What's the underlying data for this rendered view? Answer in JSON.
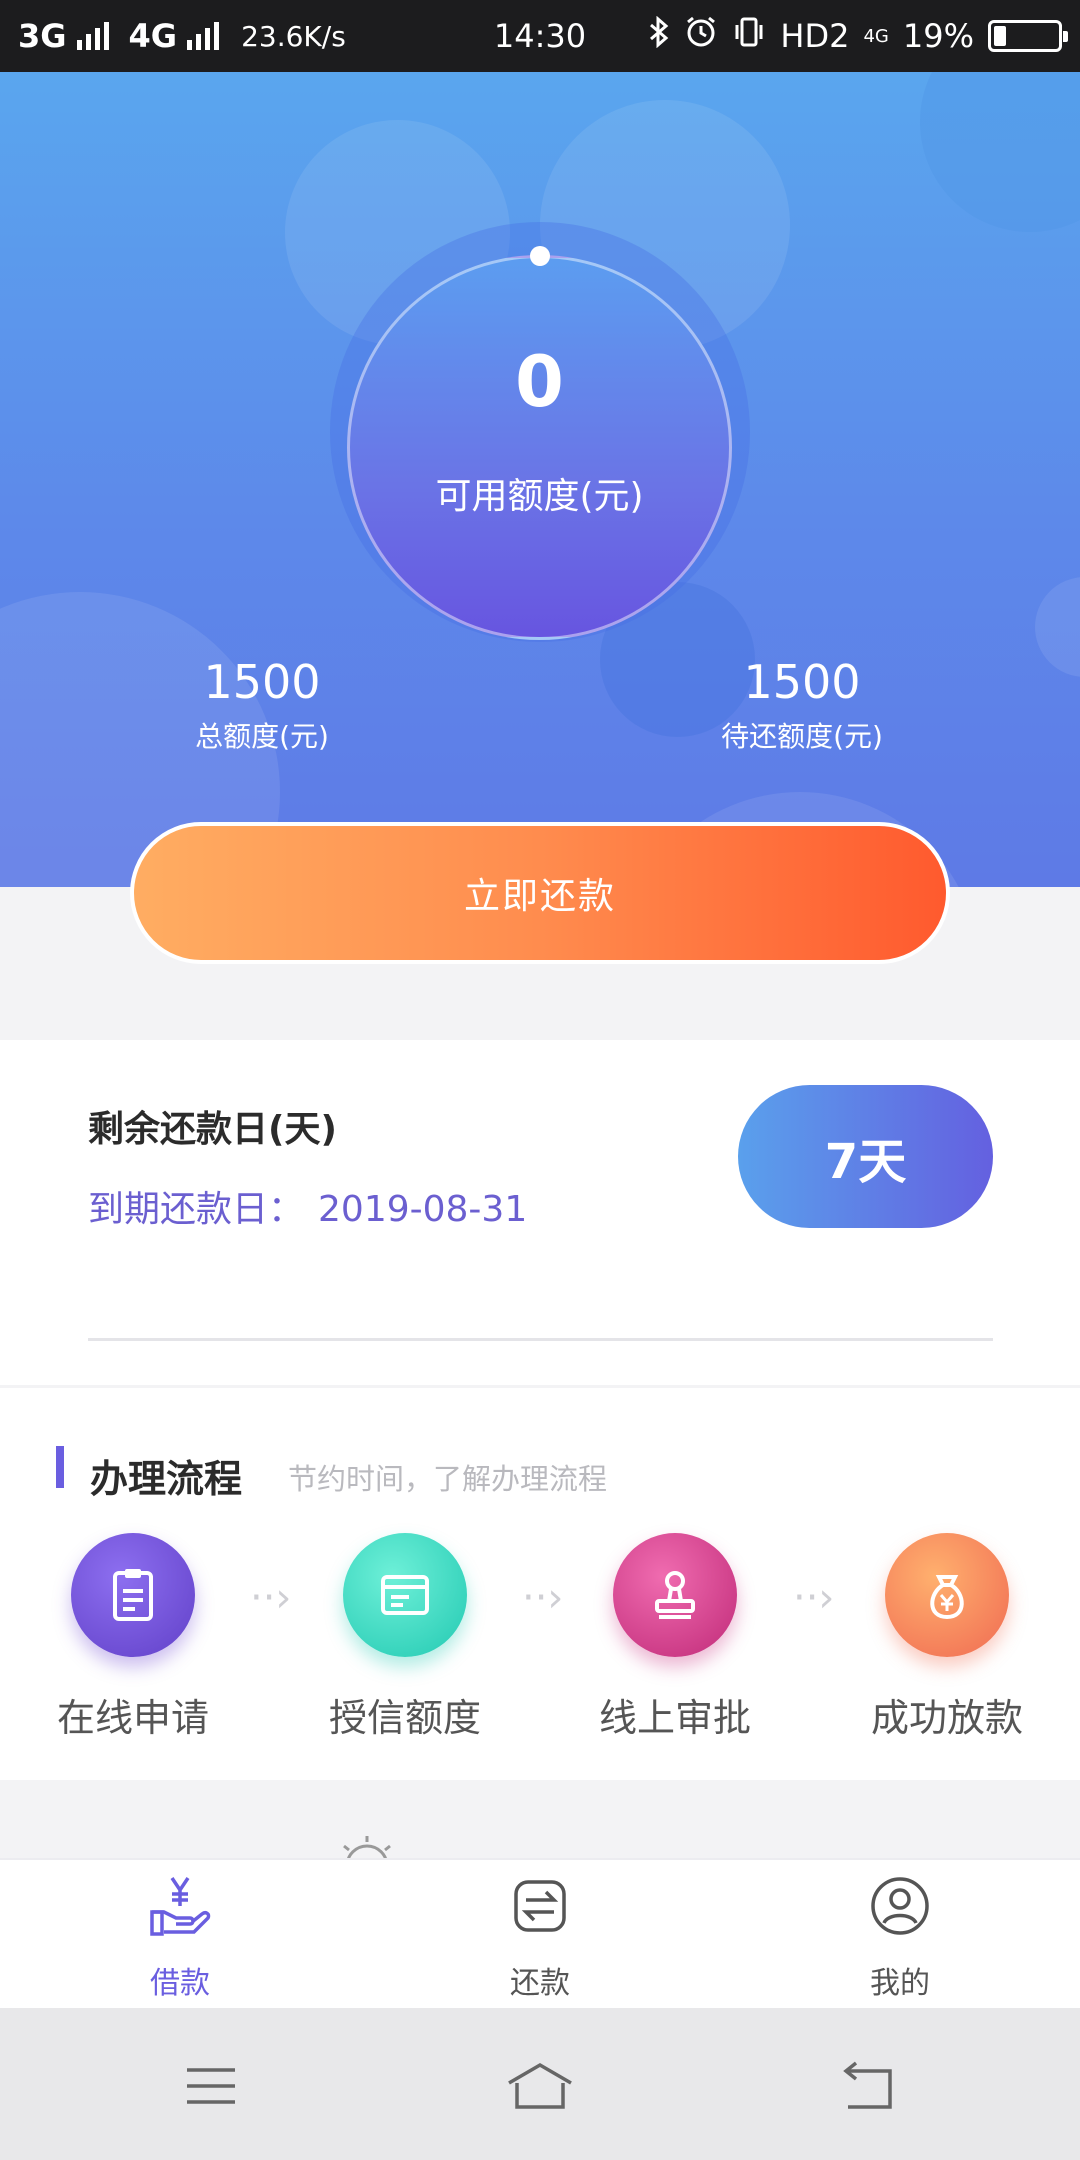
{
  "status_bar": {
    "network_1": "3G",
    "network_2": "4G",
    "speed": "23.6K/s",
    "time": "14:30",
    "hd_label": "HD2",
    "lte_label": "4G",
    "battery": "19%",
    "battery_level": 0.19
  },
  "hero": {
    "available_credit_value": "0",
    "available_credit_label": "可用额度(元)",
    "total_credit_value": "1500",
    "total_credit_label": "总额度(元)",
    "pending_repay_value": "1500",
    "pending_repay_label": "待还额度(元)",
    "repay_now_label": "立即还款"
  },
  "due_card": {
    "title": "剩余还款日(天)",
    "due_date_label": "到期还款日：",
    "due_date_value": "2019-08-31",
    "days_left": "7天"
  },
  "process": {
    "title": "办理流程",
    "subtitle": "节约时间，了解办理流程",
    "steps": [
      {
        "label": "在线申请",
        "icon": "clipboard-icon"
      },
      {
        "label": "授信额度",
        "icon": "card-icon"
      },
      {
        "label": "线上审批",
        "icon": "stamp-icon"
      },
      {
        "label": "成功放款",
        "icon": "money-bag-icon"
      }
    ]
  },
  "tab_bar": {
    "tabs": [
      {
        "label": "借款",
        "icon": "loan-icon",
        "active": true
      },
      {
        "label": "还款",
        "icon": "repay-icon",
        "active": false
      },
      {
        "label": "我的",
        "icon": "profile-icon",
        "active": false
      }
    ]
  },
  "colors": {
    "accent": "#6a5ee0",
    "repay_gradient_start": "#ffad62",
    "repay_gradient_end": "#ff5a2e",
    "hero_top": "#5aa6ee",
    "hero_bottom": "#5e7ae6",
    "tab_active": "#6a5ee0",
    "tab_inactive": "#555555"
  },
  "system_nav": {
    "icons": [
      "menu-icon",
      "home-icon",
      "back-icon"
    ]
  }
}
